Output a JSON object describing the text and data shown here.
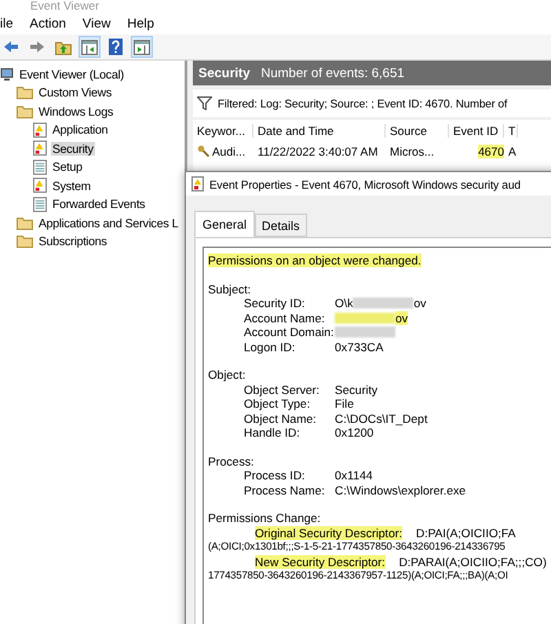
{
  "window": {
    "title": "Event Viewer"
  },
  "menu": [
    "ile",
    "Action",
    "View",
    "Help"
  ],
  "toolbar": [
    {
      "kind": "back",
      "selected": false
    },
    {
      "kind": "forward",
      "selected": false
    },
    {
      "kind": "up",
      "selected": false
    },
    {
      "kind": "tree",
      "selected": true
    },
    {
      "kind": "help",
      "selected": false
    },
    {
      "kind": "pane",
      "selected": true
    }
  ],
  "tree": [
    {
      "label": "Event Viewer (Local)",
      "kind": "computer",
      "selected": false,
      "children": [
        {
          "label": "Custom Views",
          "kind": "folder",
          "selected": false
        },
        {
          "label": "Windows Logs",
          "kind": "folder",
          "selected": false,
          "children": [
            {
              "label": "Application",
              "kind": "log-warning",
              "selected": false
            },
            {
              "label": "Security",
              "kind": "log-warning",
              "selected": true
            },
            {
              "label": "Setup",
              "kind": "log",
              "selected": false
            },
            {
              "label": "System",
              "kind": "log-warning",
              "selected": false
            },
            {
              "label": "Forwarded Events",
              "kind": "log",
              "selected": false
            }
          ]
        },
        {
          "label": "Applications and Services L",
          "kind": "folder",
          "selected": false
        },
        {
          "label": "Subscriptions",
          "kind": "folder",
          "selected": false
        }
      ]
    }
  ],
  "log_header": {
    "title": "Security",
    "count": "Number of events: 6,651"
  },
  "filter": "Filtered: Log: Security; Source: ; Event ID: 4670. Number of",
  "table": {
    "columns": [
      "Keywor...",
      "Date and Time",
      "Source",
      "Event ID",
      "T"
    ],
    "rows": [
      {
        "cells": [
          {
            "text": "Audi...",
            "highlighted": false
          },
          {
            "text": "11/22/2022 3:40:07 AM",
            "highlighted": false
          },
          {
            "text": "Micros...",
            "highlighted": false
          },
          {
            "text": "4670",
            "highlighted": true
          },
          {
            "text": "A",
            "highlighted": false
          }
        ]
      }
    ]
  },
  "dialog": {
    "title": "Event Properties - Event 4670, Microsoft Windows security aud",
    "tabs": [
      {
        "label": "General",
        "selected": true
      },
      {
        "label": "Details",
        "selected": false
      }
    ],
    "summary": {
      "text": "Permissions on an object were changed.",
      "highlighted": true
    },
    "sections": [
      {
        "heading": "Subject:",
        "fields": [
          {
            "label": "Security ID:",
            "value_start": "O\\k",
            "value_end": "ov",
            "redacted": true,
            "highlighted": false
          },
          {
            "label": "Account Name:",
            "value_end": "ov",
            "redacted": true,
            "highlighted": true
          },
          {
            "label": "Account Domain:",
            "redacted": true,
            "highlighted": false
          },
          {
            "label": "Logon ID:",
            "value_start": "0x733CA",
            "redacted": false,
            "highlighted": false
          }
        ]
      },
      {
        "heading": "Object:",
        "fields": [
          {
            "label": "Object Server:",
            "value_start": "Security",
            "redacted": false,
            "highlighted": false
          },
          {
            "label": "Object Type:",
            "value_start": "File",
            "redacted": false,
            "highlighted": false
          },
          {
            "label": "Object Name:",
            "value_start": "C:\\DOCs\\IT_Dept",
            "redacted": false,
            "highlighted": false
          },
          {
            "label": "Handle ID:",
            "value_start": "0x1200",
            "redacted": false,
            "highlighted": false
          }
        ]
      },
      {
        "heading": "Process:",
        "fields": [
          {
            "label": "Process ID:",
            "value_start": "0x1144",
            "redacted": false,
            "highlighted": false
          },
          {
            "label": "Process Name:",
            "value_start": "C:\\Windows\\explorer.exe",
            "redacted": false,
            "highlighted": false
          }
        ]
      }
    ],
    "permissions": {
      "heading": "Permissions Change:",
      "lines": [
        {
          "kind": "labeled",
          "label": "Original Security Descriptor:",
          "value": "D:PAI(A;OICIIO;FA",
          "highlighted": true
        },
        {
          "kind": "continuation",
          "value": "(A;OICI;0x1301bf;;;S-1-5-21-1774357850-3643260196-214336795",
          "highlighted": false
        },
        {
          "kind": "labeled",
          "label": "New Security Descriptor:",
          "value": "D:PARAI(A;OICIIO;FA;;;CO)",
          "highlighted": true
        },
        {
          "kind": "continuation",
          "value": "1774357850-3643260196-2143367957-1125)(A;OICI;FA;;;BA)(A;OI",
          "highlighted": false
        }
      ]
    }
  }
}
